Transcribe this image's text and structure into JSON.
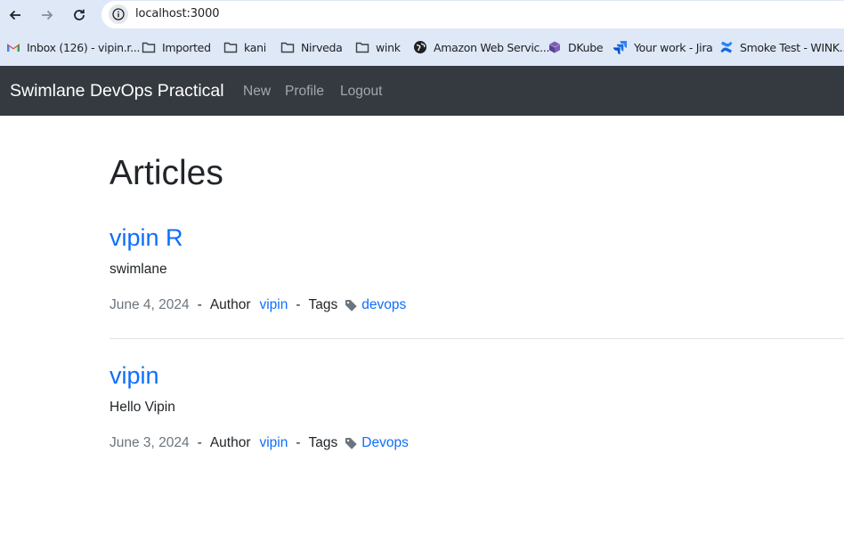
{
  "browser": {
    "url": "localhost:3000",
    "bookmarks": [
      {
        "label": "Inbox (126) - vipin.r...",
        "icon": "gmail-icon"
      },
      {
        "label": "Imported",
        "icon": "folder-icon"
      },
      {
        "label": "kani",
        "icon": "folder-icon"
      },
      {
        "label": "Nirveda",
        "icon": "folder-icon"
      },
      {
        "label": "wink",
        "icon": "folder-icon"
      },
      {
        "label": "Amazon Web Servic...",
        "icon": "globe-icon"
      },
      {
        "label": "DKube",
        "icon": "dkube-icon"
      },
      {
        "label": "Your work - Jira",
        "icon": "jira-icon"
      },
      {
        "label": "Smoke Test - WINK...",
        "icon": "confluence-icon"
      }
    ]
  },
  "navbar": {
    "brand": "Swimlane DevOps Practical",
    "links": [
      "New",
      "Profile",
      "Logout"
    ]
  },
  "page": {
    "title": "Articles",
    "articles": [
      {
        "title": "vipin R",
        "body": "swimlane",
        "date": "June 4, 2024",
        "separator": "-",
        "author_label": "Author",
        "author": "vipin",
        "tags_label": "Tags",
        "tag": "devops"
      },
      {
        "title": "vipin",
        "body": "Hello Vipin",
        "date": "June 3, 2024",
        "separator": "-",
        "author_label": "Author",
        "author": "vipin",
        "tags_label": "Tags",
        "tag": "Devops"
      }
    ]
  },
  "colors": {
    "navbar_bg": "#343a40",
    "link": "#0d6efd",
    "muted": "#6c757d",
    "chrome_bg": "#dfe8f7"
  }
}
